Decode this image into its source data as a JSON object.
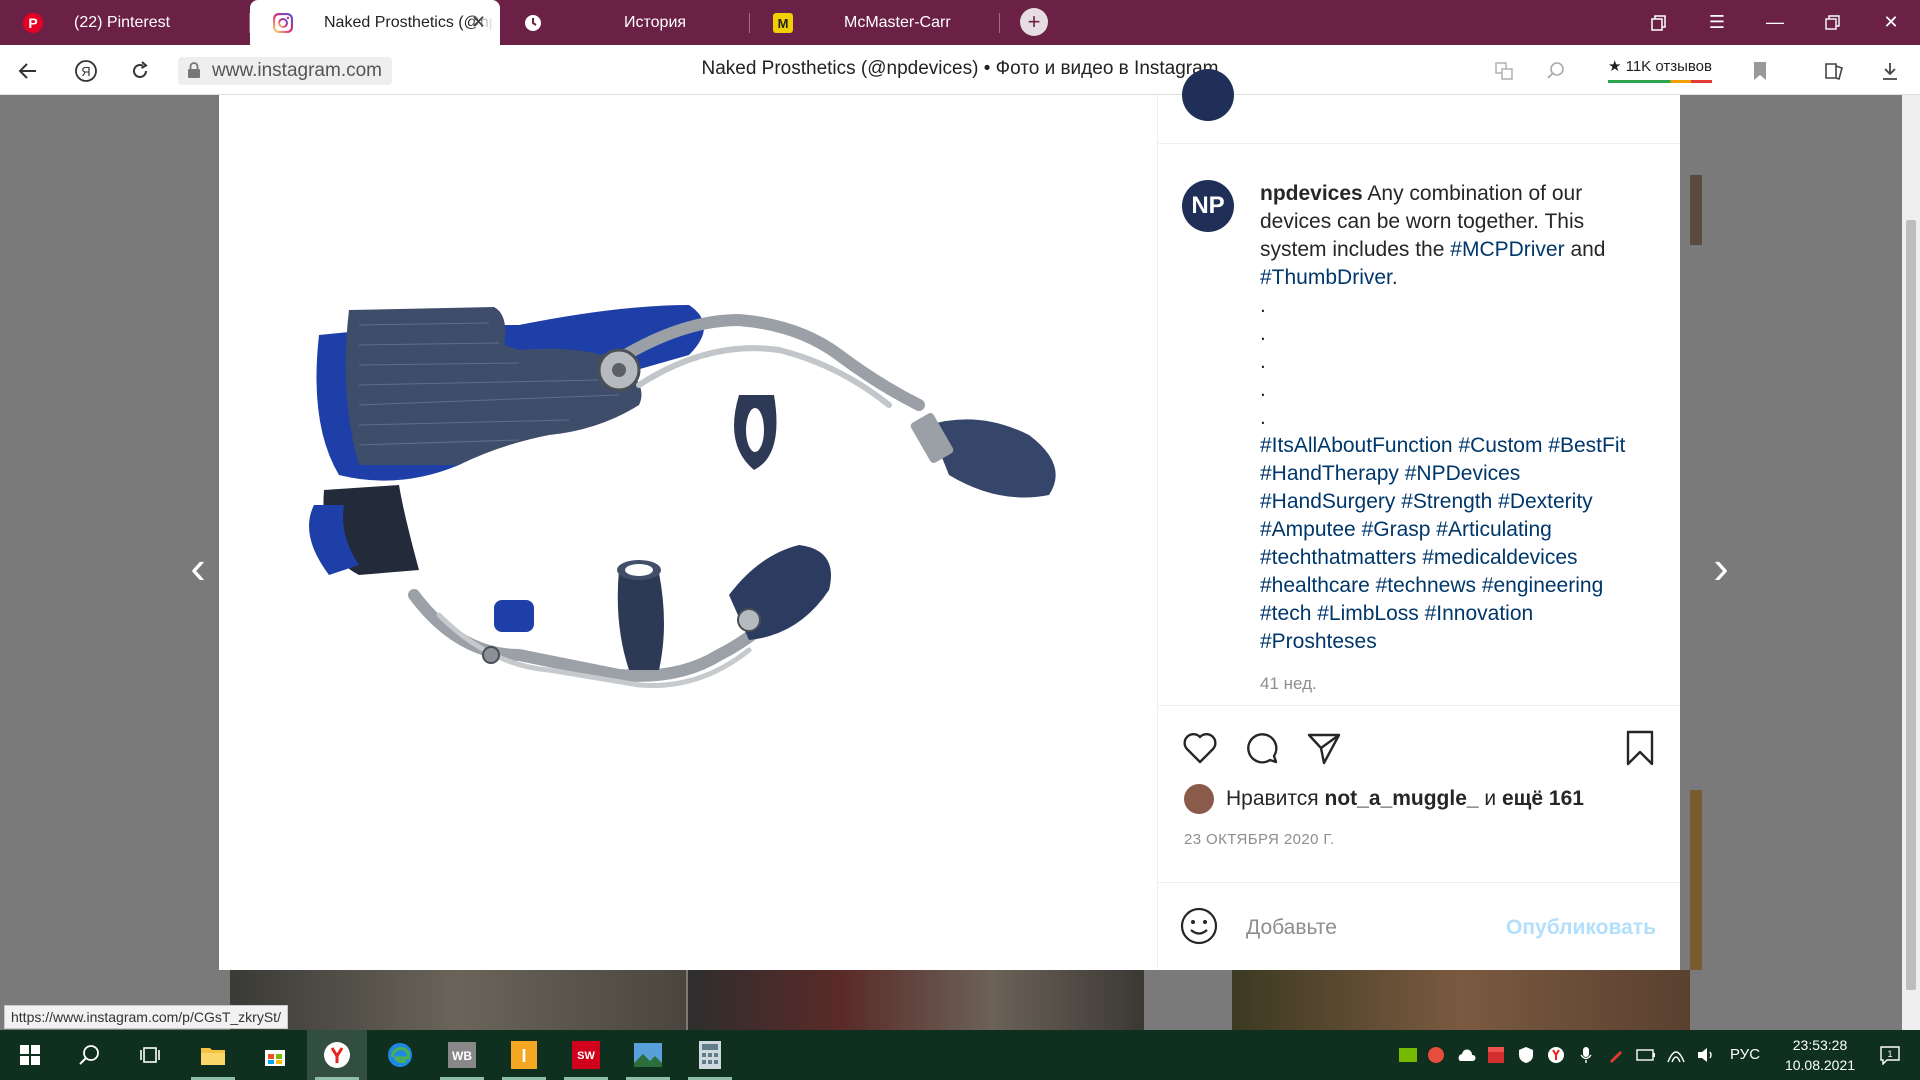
{
  "tabs": [
    {
      "label": "(22) Pinterest",
      "icon": "pinterest-icon"
    },
    {
      "label": "Naked Prosthetics (@npdevices)",
      "icon": "instagram-icon",
      "active": true
    },
    {
      "label": "История",
      "icon": "history-icon"
    },
    {
      "label": "McMaster-Carr",
      "icon": "mcmaster-icon"
    }
  ],
  "address": {
    "url": "www.instagram.com",
    "page_title": "Naked Prosthetics (@npdevices) • Фото и видео в Instagram",
    "reviews": "★ 11K отзывов"
  },
  "post": {
    "avatar_text": "NP",
    "username": "npdevices",
    "caption_text": "Any combination of our devices can be worn together. This system includes the",
    "tag1": "#MCPDriver",
    "caption_and": "and",
    "tag2": "#ThumbDriver",
    "caption_period": ".",
    "dots": [
      ".",
      ".",
      ".",
      ".",
      "."
    ],
    "hashtags": "#ItsAllAboutFunction #Custom #BestFit #HandTherapy #NPDevices #HandSurgery #Strength #Dexterity #Amputee #Grasp #Articulating #techthatmatters #medicaldevices #healthcare #technews #engineering #tech #LimbLoss #Innovation #Proshteses",
    "time_ago": "41 нед.",
    "likes_prefix": "Нравится",
    "likes_user": "not_a_muggle_",
    "likes_and": "и",
    "likes_more": "ещё 161",
    "date": "23 ОКТЯБРЯ 2020 Г.",
    "comment_placeholder": "Добавьте",
    "post_button": "Опубликовать"
  },
  "status_link": "https://www.instagram.com/p/CGsT_zkrySt/",
  "tray": {
    "lang": "РУС",
    "time": "23:53:28",
    "date": "10.08.2021",
    "notifications": "1"
  },
  "colors": {
    "tab_bar": "#6b2146",
    "taskbar": "#0f2f1f",
    "link": "#00376b",
    "avatar": "#1f2f57"
  }
}
